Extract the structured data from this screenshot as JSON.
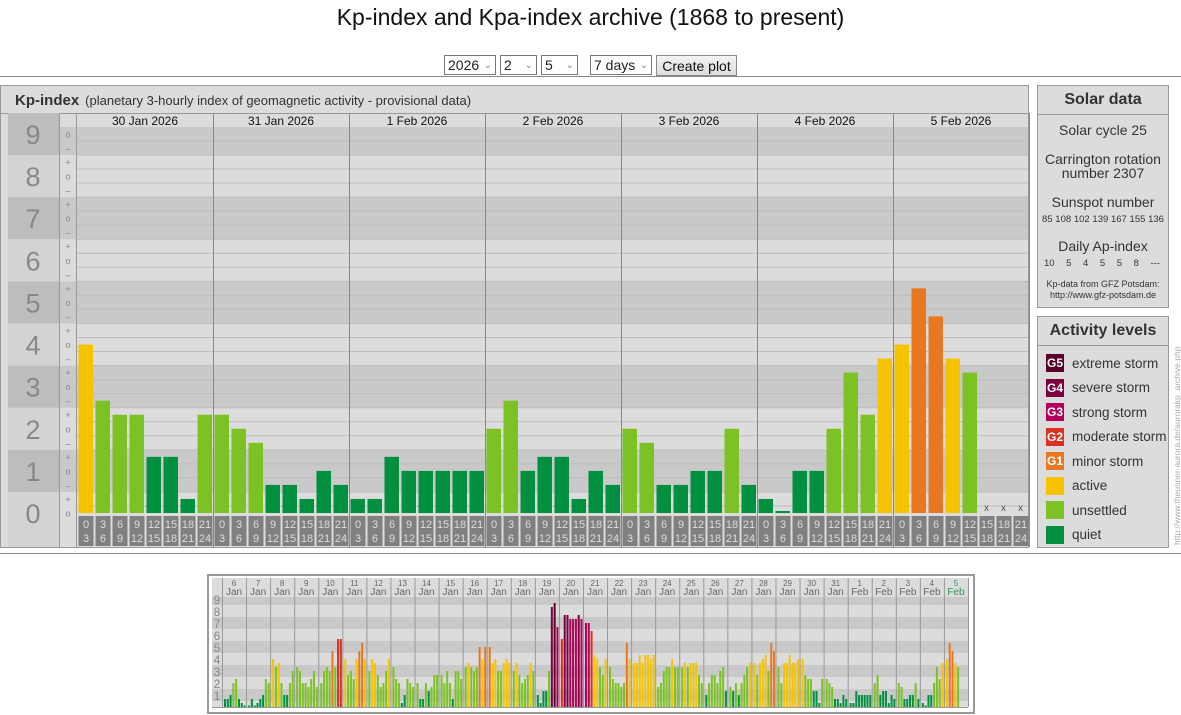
{
  "title": "Kp-index and Kpa-index archive (1868 to present)",
  "controls": {
    "year": "2026",
    "month": "2",
    "day": "5",
    "range": "7 days",
    "create_plot": "Create plot"
  },
  "main": {
    "heading": "Kp-index",
    "subheading": "(planetary 3-hourly index of geomagnetic activity - provisional data)"
  },
  "solar": {
    "heading": "Solar data",
    "cycle": "Solar cycle 25",
    "carrington_line1": "Carrington rotation",
    "carrington_line2": "number 2307",
    "sunspot_label": "Sunspot number",
    "sunspot_values": [
      "85",
      "108",
      "102",
      "139",
      "167",
      "155",
      "136"
    ],
    "ap_label": "Daily Ap-index",
    "ap_values": [
      "10",
      "5",
      "4",
      "5",
      "5",
      "8",
      "---"
    ],
    "source_line1": "Kp-data from  GFZ Potsdam:",
    "source_line2": "http://www.gfz-potsdam.de"
  },
  "activity": {
    "heading": "Activity levels",
    "levels": [
      {
        "badge": "G5",
        "label": "extreme storm",
        "color": "#580028"
      },
      {
        "badge": "G4",
        "label": "severe storm",
        "color": "#7a0040"
      },
      {
        "badge": "G3",
        "label": "strong storm",
        "color": "#b0005a"
      },
      {
        "badge": "G2",
        "label": "moderate storm",
        "color": "#dc3020"
      },
      {
        "badge": "G1",
        "label": "minor storm",
        "color": "#e87820"
      },
      {
        "badge": "",
        "label": "active",
        "color": "#f7c300"
      },
      {
        "badge": "",
        "label": "unsettled",
        "color": "#7cc224"
      },
      {
        "badge": "",
        "label": "quiet",
        "color": "#009040"
      }
    ]
  },
  "watermark": "http://www.theusner-aurora.de/aurorakp_archive.php",
  "chart_data": [
    {
      "type": "bar",
      "title": "Kp-index",
      "ylabel": "Kp",
      "ylim": [
        0,
        9
      ],
      "y_ticks": [
        "0",
        "1",
        "2",
        "3",
        "4",
        "5",
        "6",
        "7",
        "8",
        "9"
      ],
      "x_sublabels": [
        [
          "0",
          "3"
        ],
        [
          "3",
          "6"
        ],
        [
          "6",
          "9"
        ],
        [
          "9",
          "12"
        ],
        [
          "12",
          "15"
        ],
        [
          "15",
          "18"
        ],
        [
          "18",
          "21"
        ],
        [
          "21",
          "24"
        ]
      ],
      "missing_marker": "x",
      "days": [
        {
          "date": "30 Jan 2026",
          "kp": [
            "4o",
            "3-",
            "2+",
            "2+",
            "1+",
            "1+",
            "0+",
            "2+"
          ]
        },
        {
          "date": "31 Jan 2026",
          "kp": [
            "2+",
            "2o",
            "2-",
            "1-",
            "1-",
            "0+",
            "1o",
            "1-"
          ]
        },
        {
          "date": "1 Feb 2026",
          "kp": [
            "0+",
            "0+",
            "1+",
            "1o",
            "1o",
            "1o",
            "1o",
            "1o"
          ]
        },
        {
          "date": "2 Feb 2026",
          "kp": [
            "2o",
            "3-",
            "1o",
            "1+",
            "1+",
            "0+",
            "1o",
            "1-"
          ]
        },
        {
          "date": "3 Feb 2026",
          "kp": [
            "2o",
            "2-",
            "1-",
            "1-",
            "1o",
            "1o",
            "2o",
            "1-"
          ]
        },
        {
          "date": "4 Feb 2026",
          "kp": [
            "0+",
            "0o",
            "1o",
            "1o",
            "2o",
            "3+",
            "2+",
            "4-"
          ]
        },
        {
          "date": "5 Feb 2026",
          "kp": [
            "4o",
            "5+",
            "5-",
            "4-",
            "3+",
            null,
            null,
            null
          ]
        }
      ]
    },
    {
      "type": "bar",
      "title": "Kp-index last 31 days",
      "ylim": [
        0,
        9
      ],
      "units": "thirds of Kp",
      "y_ticks": [
        "1",
        "2",
        "3",
        "4",
        "5",
        "6",
        "7",
        "8",
        "9"
      ],
      "days": [
        {
          "d": "6",
          "m": "Jan",
          "v": [
            2,
            2,
            3,
            6,
            7,
            2,
            1,
            0
          ]
        },
        {
          "d": "7",
          "m": "Jan",
          "v": [
            0,
            2,
            0,
            1,
            2,
            3,
            7,
            6
          ]
        },
        {
          "d": "8",
          "m": "Jan",
          "v": [
            12,
            10,
            11,
            6,
            3,
            3,
            6,
            9
          ]
        },
        {
          "d": "9",
          "m": "Jan",
          "v": [
            10,
            9,
            6,
            6,
            5,
            7,
            9,
            5
          ]
        },
        {
          "d": "10",
          "m": "Jan",
          "v": [
            6,
            9,
            10,
            9,
            14,
            10,
            17,
            17
          ]
        },
        {
          "d": "11",
          "m": "Jan",
          "v": [
            12,
            8,
            9,
            7,
            12,
            14,
            16,
            12
          ]
        },
        {
          "d": "12",
          "m": "Jan",
          "v": [
            9,
            12,
            11,
            8,
            5,
            6,
            9,
            12
          ]
        },
        {
          "d": "13",
          "m": "Jan",
          "v": [
            10,
            7,
            6,
            1,
            3,
            7,
            6,
            5
          ]
        },
        {
          "d": "14",
          "m": "Jan",
          "v": [
            6,
            2,
            2,
            6,
            4,
            5,
            8,
            8
          ]
        },
        {
          "d": "15",
          "m": "Jan",
          "v": [
            8,
            6,
            9,
            6,
            2,
            9,
            9,
            7
          ]
        },
        {
          "d": "16",
          "m": "Jan",
          "v": [
            10,
            11,
            10,
            9,
            10,
            15,
            12,
            15
          ]
        },
        {
          "d": "17",
          "m": "Jan",
          "v": [
            15,
            11,
            12,
            9,
            9,
            11,
            12,
            11
          ]
        },
        {
          "d": "18",
          "m": "Jan",
          "v": [
            9,
            11,
            8,
            6,
            7,
            8,
            11,
            9
          ]
        },
        {
          "d": "19",
          "m": "Jan",
          "v": [
            3,
            1,
            4,
            4,
            9,
            25,
            26,
            20
          ]
        },
        {
          "d": "20",
          "m": "Jan",
          "v": [
            17,
            23,
            23,
            22,
            22,
            22,
            23,
            22
          ]
        },
        {
          "d": "21",
          "m": "Jan",
          "v": [
            21,
            21,
            19,
            13,
            12,
            10,
            8,
            12
          ]
        },
        {
          "d": "22",
          "m": "Jan",
          "v": [
            10,
            7,
            6,
            6,
            5,
            6,
            16,
            12
          ]
        },
        {
          "d": "23",
          "m": "Jan",
          "v": [
            11,
            11,
            13,
            11,
            13,
            13,
            12,
            13
          ]
        },
        {
          "d": "24",
          "m": "Jan",
          "v": [
            5,
            6,
            9,
            10,
            10,
            12,
            10,
            10
          ]
        },
        {
          "d": "25",
          "m": "Jan",
          "v": [
            10,
            11,
            10,
            11,
            11,
            11,
            8,
            6
          ]
        },
        {
          "d": "26",
          "m": "Jan",
          "v": [
            3,
            6,
            8,
            8,
            6,
            9,
            10,
            4
          ]
        },
        {
          "d": "27",
          "m": "Jan",
          "v": [
            5,
            4,
            6,
            3,
            6,
            8,
            10,
            11
          ]
        },
        {
          "d": "28",
          "m": "Jan",
          "v": [
            11,
            8,
            11,
            12,
            13,
            9,
            16,
            14
          ]
        },
        {
          "d": "29",
          "m": "Jan",
          "v": [
            10,
            6,
            11,
            11,
            13,
            11,
            11,
            12
          ]
        },
        {
          "d": "30",
          "m": "Jan",
          "v": [
            12,
            8,
            7,
            7,
            4,
            4,
            1,
            7
          ]
        },
        {
          "d": "31",
          "m": "Jan",
          "v": [
            7,
            6,
            5,
            2,
            2,
            1,
            3,
            2
          ]
        },
        {
          "d": "1",
          "m": "Feb",
          "v": [
            1,
            1,
            4,
            3,
            3,
            3,
            3,
            3
          ]
        },
        {
          "d": "2",
          "m": "Feb",
          "v": [
            6,
            8,
            3,
            4,
            4,
            1,
            3,
            2
          ]
        },
        {
          "d": "3",
          "m": "Feb",
          "v": [
            6,
            5,
            2,
            2,
            3,
            3,
            6,
            2
          ]
        },
        {
          "d": "4",
          "m": "Feb",
          "v": [
            1,
            0,
            3,
            3,
            6,
            10,
            7,
            11
          ]
        },
        {
          "d": "5",
          "m": "Feb",
          "v": [
            12,
            16,
            14,
            11,
            10,
            null,
            null,
            null
          ],
          "current": true
        }
      ]
    }
  ]
}
